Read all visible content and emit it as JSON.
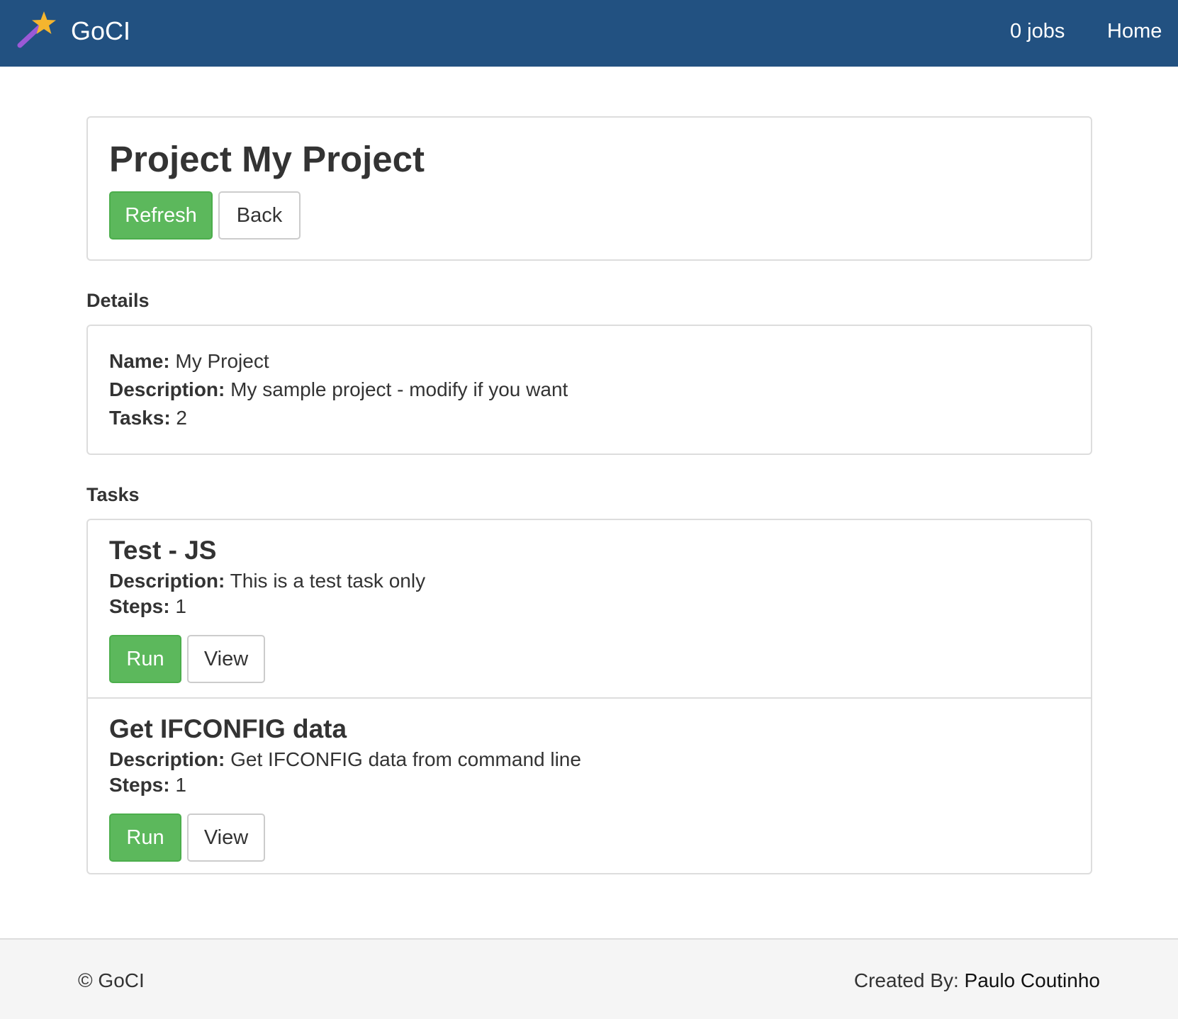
{
  "navbar": {
    "brand": "GoCI",
    "logo_icon": "magic-wand-star-icon",
    "links": {
      "jobs": "0 jobs",
      "home": "Home"
    },
    "background": "#225181"
  },
  "header": {
    "title": "Project My Project",
    "refresh_label": "Refresh",
    "back_label": "Back"
  },
  "details": {
    "heading": "Details",
    "name_label": "Name:",
    "name_value": "My Project",
    "description_label": "Description:",
    "description_value": "My sample project - modify if you want",
    "tasks_label": "Tasks:",
    "tasks_value": "2"
  },
  "tasks": {
    "heading": "Tasks",
    "items": [
      {
        "title": "Test - JS",
        "description_label": "Description:",
        "description": "This is a test task only",
        "steps_label": "Steps:",
        "steps": "1",
        "run_label": "Run",
        "view_label": "View"
      },
      {
        "title": "Get IFCONFIG data",
        "description_label": "Description:",
        "description": "Get IFCONFIG data from command line",
        "steps_label": "Steps:",
        "steps": "1",
        "run_label": "Run",
        "view_label": "View"
      }
    ]
  },
  "footer": {
    "copyright": "© GoCI",
    "created_by_label": "Created By:",
    "author": "Paulo Coutinho"
  },
  "colors": {
    "success": "#5cb85c",
    "border": "#dddddd",
    "text": "#333333"
  }
}
